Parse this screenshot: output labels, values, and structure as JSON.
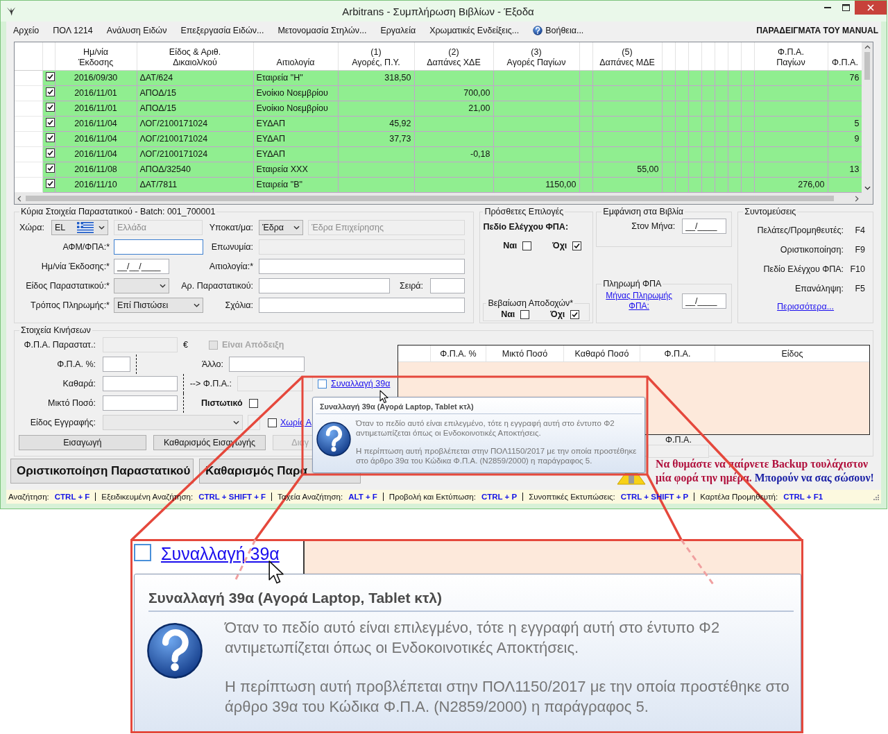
{
  "window": {
    "title": "Arbitrans - Συμπλήρωση Βιβλίων - Έξοδα"
  },
  "menu": {
    "items": [
      {
        "label": "Αρχείο",
        "kind": "plain"
      },
      {
        "label": "ΠΟΛ 1214",
        "kind": "plain"
      },
      {
        "label": "Ανάλυση Ειδών",
        "kind": "plain"
      },
      {
        "label": "Επεξεργασία Ειδών...",
        "kind": "plain"
      },
      {
        "label": "Μετονομασία Στηλών...",
        "kind": "plain"
      },
      {
        "label": "Εργαλεία",
        "kind": "plain"
      },
      {
        "label": "Χρωματικές Ενδείξεις...",
        "kind": "plain"
      },
      {
        "label": "Βοήθεια...",
        "kind": "help"
      }
    ],
    "banner": "ΠΑΡΑΔΕΙΓΜΑΤΑ ΤΟΥ MANUAL"
  },
  "grid": {
    "columns": [
      "Ημ/νία\nΈκδοσης",
      "Είδος & Αριθ.\nΔικαιολ/κού",
      "Αιτιολογία",
      "(1)\nΑγορές, Π.Υ.",
      "(2)\nΔαπάνες ΧΔΕ",
      "(3)\nΑγορές Παγίων",
      "(5)\nΔαπάνες ΜΔΕ",
      "Φ.Π.Α.\nΠαγίων",
      "Φ.Π.Α."
    ],
    "rows": [
      {
        "checked": true,
        "date": "2016/09/30",
        "doc": "ΔΑΤ/624",
        "reason": "Εταιρεία \"Η\"",
        "purchases_goods": "318,50",
        "vat": "76"
      },
      {
        "checked": true,
        "date": "2016/11/01",
        "doc": "ΑΠΟΔ/15",
        "reason": "Ενοίκιο Νοεμβρίου",
        "expenses_xde": "700,00"
      },
      {
        "checked": true,
        "date": "2016/11/01",
        "doc": "ΑΠΟΔ/15",
        "reason": "Ενοίκιο Νοεμβρίου",
        "expenses_xde": "21,00"
      },
      {
        "checked": true,
        "date": "2016/11/04",
        "doc": "ΛΟΓ/2100171024",
        "reason": "ΕΥΔΑΠ",
        "purchases_goods": "45,92",
        "vat": "5"
      },
      {
        "checked": true,
        "date": "2016/11/04",
        "doc": "ΛΟΓ/2100171024",
        "reason": "ΕΥΔΑΠ",
        "purchases_goods": "37,73",
        "vat": "9"
      },
      {
        "checked": true,
        "date": "2016/11/04",
        "doc": "ΛΟΓ/2100171024",
        "reason": "ΕΥΔΑΠ",
        "expenses_xde": "-0,18"
      },
      {
        "checked": true,
        "date": "2016/11/08",
        "doc": "ΑΠΟΔ/32540",
        "reason": "Εταιρεία ΧΧΧ",
        "expenses_mde": "55,00",
        "vat": "13"
      },
      {
        "checked": true,
        "date": "2016/11/10",
        "doc": "ΔΑΤ/7811",
        "reason": "Εταιρεία \"Β\"",
        "fixed_assets": "1150,00",
        "vat_fixed": "276,00"
      }
    ]
  },
  "main_details": {
    "legend": "Κύρια Στοιχεία Παραστατικού - Batch: 001_700001",
    "country": {
      "label": "Χώρα:",
      "value": "EL",
      "name": "Ελλάδα"
    },
    "branch": {
      "label": "Υποκατ/μα:",
      "value": "Έδρα",
      "name": "Έδρα Επιχείρησης"
    },
    "vat_id": {
      "label": "ΑΦΜ/ΦΠΑ:*"
    },
    "company": {
      "label": "Επωνυμία:"
    },
    "issue_date": {
      "label": "Ημ/νία Έκδοσης:*",
      "value": "__/__/____"
    },
    "reason": {
      "label": "Αιτιολογία:*"
    },
    "doc_type": {
      "label": "Είδος Παραστατικού:*"
    },
    "doc_number": {
      "label": "Αρ. Παραστατικού:"
    },
    "series": {
      "label": "Σειρά:"
    },
    "payment": {
      "label": "Τρόπος Πληρωμής:*",
      "value": "Επί Πιστώσει"
    },
    "comments": {
      "label": "Σχόλια:"
    }
  },
  "options": {
    "legend": "Πρόσθετες Επιλογές",
    "vat_check": {
      "label": "Πεδίο Ελέγχου ΦΠΑ:",
      "yes": {
        "label": "Ναι",
        "checked": false
      },
      "no": {
        "label": "Όχι",
        "checked": true
      }
    },
    "income_cert": {
      "legend": "Βεβαίωση Αποδοχών*",
      "yes": {
        "label": "Ναι",
        "checked": false
      },
      "no": {
        "label": "Όχι",
        "checked": true
      }
    }
  },
  "books": {
    "legend": "Εμφάνιση στα Βιβλία",
    "month_label": "Στον Μήνα:",
    "month_value": "__/____"
  },
  "vat_payment": {
    "legend": "Πληρωμή ΦΠΑ",
    "link": "Μήνας Πληρωμής ΦΠΑ:",
    "value": "__/____"
  },
  "shortcuts": {
    "legend": "Συντομεύσεις",
    "items": [
      {
        "label": "Πελάτες/Προμηθευτές:",
        "key": "F4"
      },
      {
        "label": "Οριστικοποίηση:",
        "key": "F9"
      },
      {
        "label": "Πεδίο Ελέγχου ΦΠΑ:",
        "key": "F10"
      },
      {
        "label": "Επανάληψη:",
        "key": "F5"
      }
    ],
    "more": "Περισσότερα..."
  },
  "movements": {
    "legend": "Στοιχεία Κινήσεων",
    "vat_doc_label": "Φ.Π.Α. Παραστατ.:",
    "currency": "€",
    "receipt": {
      "label": "Είναι Απόδειξη",
      "checked": false,
      "disabled": true
    },
    "vat_pct_label": "Φ.Π.Α. %:",
    "other_label": "Άλλο:",
    "net_label": "Καθαρά:",
    "vat_arrow_label": "--> Φ.Π.Α.:",
    "gross_label": "Μικτό Ποσό:",
    "credit": {
      "label": "Πιστωτικό",
      "checked": false
    },
    "transaction": {
      "label": "Συναλλαγή 39α",
      "checked": false
    },
    "entry_type_label": "Είδος Εγγραφής:",
    "no_link": {
      "label": "Χωρίς Α",
      "checked": false
    },
    "buttons": [
      {
        "label": "Εισαγωγή",
        "disabled": false
      },
      {
        "label": "Καθαρισμός Εισαγωγής",
        "disabled": false
      },
      {
        "label": "Διαγ",
        "disabled": true
      }
    ]
  },
  "vat_table": {
    "columns": [
      "Φ.Π.Α. %",
      "Μικτό Ποσό",
      "Καθαρό Ποσό",
      "Φ.Π.Α.",
      "Είδος"
    ],
    "total_label": "Φ.Π.Α."
  },
  "actions": [
    {
      "label": "Οριστικοποίηση Παραστατικού"
    },
    {
      "label": "Καθαρισμός Παρα"
    }
  ],
  "backup_notice": {
    "reminder": "Να θυμάστε να παίρνετε Backup τουλάχιστον μία φορά την ημέρα.",
    "tip": "Μπορούν να σας σώσουν!"
  },
  "tooltip": {
    "title": "Συναλλαγή 39α (Αγορά Laptop, Tablet κτλ)",
    "paragraphs": [
      "Όταν το πεδίο αυτό είναι επιλεγμένο, τότε η εγγραφή αυτή στο έντυπο Φ2 αντιμετωπίζεται όπως οι Ενδοκοινοτικές Αποκτήσεις.",
      "Η περίπτωση αυτή προβλέπεται στην ΠΟΛ1150/2017 με την οποία προστέθηκε στο άρθρο 39α του Κώδικα Φ.Π.Α. (N2859/2000) η παράγραφος 5."
    ]
  },
  "status_bar": [
    {
      "label": "Αναζήτηση:",
      "keys": "CTRL + F"
    },
    {
      "label": "Εξειδικευμένη Αναζήτηση:",
      "keys": "CTRL + SHIFT + F"
    },
    {
      "label": "Ταχεία Αναζήτηση:",
      "keys": "ALT + F"
    },
    {
      "label": "Προβολή και Εκτύπωση:",
      "keys": "CTRL + P"
    },
    {
      "label": "Συνοπτικές Εκτυπώσεις:",
      "keys": "CTRL + SHIFT + P"
    },
    {
      "label": "Καρτέλα Προμηθευτή:",
      "keys": "CTRL + F1"
    }
  ],
  "magnifier": {
    "transaction": {
      "label": "Συναλλαγή 39α",
      "checked": false
    },
    "tooltip": {
      "title": "Συναλλαγή 39α (Αγορά Laptop, Tablet κτλ)",
      "paragraphs": [
        "Όταν το πεδίο αυτό είναι επιλεγμένο, τότε η εγγραφή αυτή στο έντυπο Φ2 αντιμετωπίζεται όπως οι Ενδοκοινοτικές Αποκτήσεις.",
        "Η περίπτωση αυτή προβλέπεται στην ΠΟΛ1150/2017 με την οποία προστέθηκε στο άρθρο 39α του Κώδικα Φ.Π.Α. (N2859/2000) η παράγραφος 5."
      ]
    }
  }
}
